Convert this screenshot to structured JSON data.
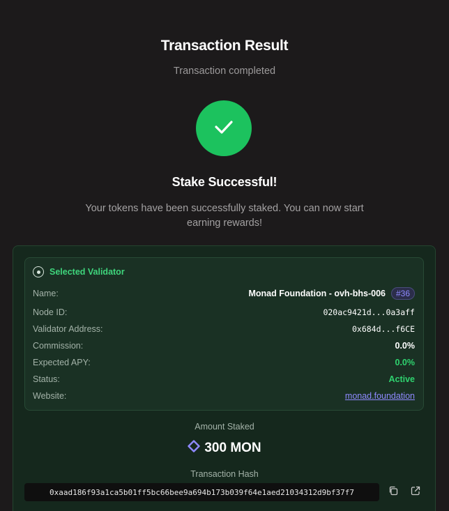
{
  "header": {
    "title": "Transaction Result",
    "subtitle": "Transaction completed"
  },
  "result": {
    "icon": "check-icon",
    "heading": "Stake Successful!",
    "message": "Your tokens have been successfully staked. You can now start earning rewards!",
    "accent_color": "#1cc25e"
  },
  "validator": {
    "section_title": "Selected Validator",
    "rows": {
      "name": {
        "label": "Name:",
        "value": "Monad Foundation - ovh-bhs-006",
        "badge": "#36"
      },
      "node_id": {
        "label": "Node ID:",
        "value": "020ac9421d...0a3aff"
      },
      "address": {
        "label": "Validator Address:",
        "value": "0x684d...f6CE"
      },
      "commission": {
        "label": "Commission:",
        "value": "0.0%"
      },
      "apy": {
        "label": "Expected APY:",
        "value": "0.0%"
      },
      "status": {
        "label": "Status:",
        "value": "Active"
      },
      "website": {
        "label": "Website:",
        "value": "monad.foundation"
      }
    }
  },
  "amount": {
    "label": "Amount Staked",
    "value": "300 MON",
    "icon": "monad-diamond-icon"
  },
  "transaction": {
    "label": "Transaction Hash",
    "hash": "0xaad186f93a1ca5b01ff5bc66bee9a694b173b039f64e1aed21034312d9bf37f7",
    "copy_icon": "copy-icon",
    "open_icon": "external-link-icon"
  }
}
